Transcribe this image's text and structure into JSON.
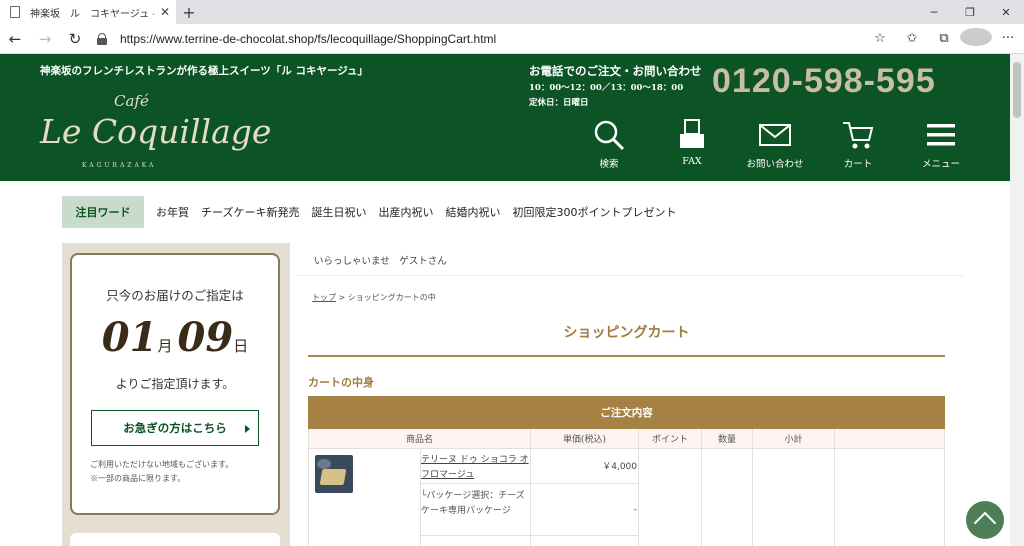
{
  "browser": {
    "tab_title": "神楽坂　ル　コキヤージュ - ショッピ",
    "url": "https://www.terrine-de-chocolat.shop/fs/lecoquillage/ShoppingCart.html"
  },
  "header": {
    "tagline": "神楽坂のフレンチレストランが作る極上スイーツ「ル コキヤージュ」",
    "logo": {
      "cafe": "Café",
      "name": "Le Coquillage",
      "sub": "KAGURAZAKA"
    },
    "phone_label": "お電話でのご注文・お問い合わせ",
    "hours": "10：00〜12：00／13：00〜18：00",
    "holiday": "定休日：日曜日",
    "phone_number": "0120-598-595",
    "icons": [
      {
        "label": "検索"
      },
      {
        "label": "FAX"
      },
      {
        "label": "お問い合わせ"
      },
      {
        "label": "カート"
      },
      {
        "label": "メニュー"
      }
    ]
  },
  "keywords": {
    "title": "注目ワード",
    "items": [
      "お年賀",
      "チーズケーキ新発売",
      "誕生日祝い",
      "出産内祝い",
      "結婚内祝い",
      "初回限定300ポイントプレゼント"
    ]
  },
  "delivery": {
    "label": "只今のお届けのご指定は",
    "month": "01",
    "month_unit": "月",
    "day": "09",
    "day_unit": "日",
    "note": "よりご指定頂けます。",
    "urgent_button": "お急ぎの方はこちら",
    "small1": "ご利用いただけない地域もございます。",
    "small2": "※一部の商品に限ります。"
  },
  "main": {
    "welcome": "いらっしゃいませ　ゲストさん",
    "breadcrumb_home": "トップ",
    "breadcrumb_current": " > ショッピングカートの中",
    "title": "ショッピングカート",
    "section": "カートの中身",
    "table": {
      "header": "ご注文内容",
      "columns": [
        "商品名",
        "単価(税込)",
        "ポイント",
        "数量",
        "小計",
        ""
      ],
      "item": {
        "name": "テリーヌ ドゥ ショコラ オ フロマージュ",
        "price": "￥4,000",
        "option": "└パッケージ選択：チーズケーキ専用パッケージ",
        "option_price": "-"
      }
    }
  }
}
